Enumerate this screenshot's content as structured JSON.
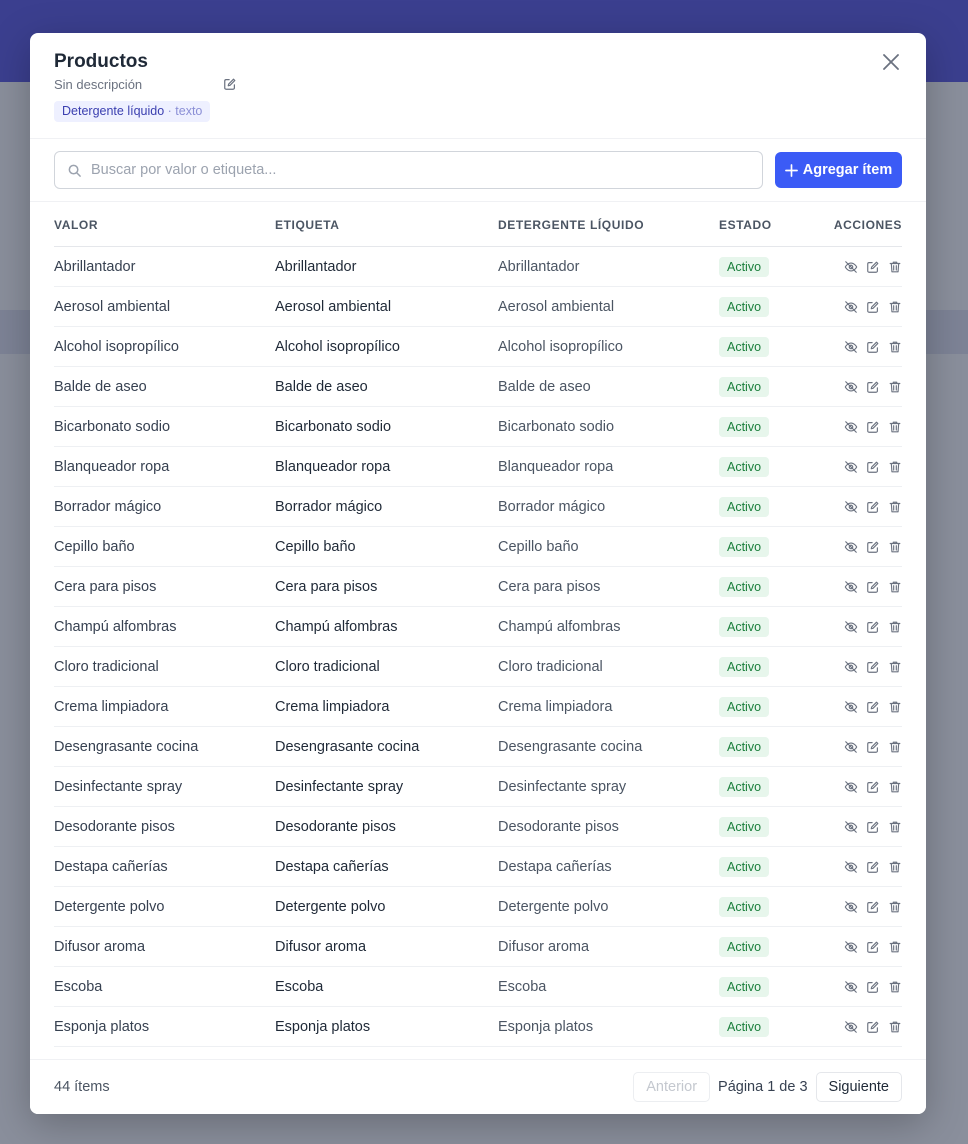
{
  "modal": {
    "title": "Productos",
    "description": "Sin descripción",
    "tag": {
      "name": "Detergente líquido",
      "type": "· texto"
    }
  },
  "search": {
    "placeholder": "Buscar por valor o etiqueta...",
    "value": ""
  },
  "add_button": {
    "label": "Agregar ítem"
  },
  "table": {
    "headers": [
      "Valor",
      "Etiqueta",
      "Detergente líquido",
      "Estado",
      "Acciones"
    ],
    "rows": [
      {
        "valor": "Abrillantador",
        "etiqueta": "Abrillantador",
        "detergente": "Abrillantador",
        "estado": "Activo"
      },
      {
        "valor": "Aerosol ambiental",
        "etiqueta": "Aerosol ambiental",
        "detergente": "Aerosol ambiental",
        "estado": "Activo"
      },
      {
        "valor": "Alcohol isopropílico",
        "etiqueta": "Alcohol isopropílico",
        "detergente": "Alcohol isopropílico",
        "estado": "Activo"
      },
      {
        "valor": "Balde de aseo",
        "etiqueta": "Balde de aseo",
        "detergente": "Balde de aseo",
        "estado": "Activo"
      },
      {
        "valor": "Bicarbonato sodio",
        "etiqueta": "Bicarbonato sodio",
        "detergente": "Bicarbonato sodio",
        "estado": "Activo"
      },
      {
        "valor": "Blanqueador ropa",
        "etiqueta": "Blanqueador ropa",
        "detergente": "Blanqueador ropa",
        "estado": "Activo"
      },
      {
        "valor": "Borrador mágico",
        "etiqueta": "Borrador mágico",
        "detergente": "Borrador mágico",
        "estado": "Activo"
      },
      {
        "valor": "Cepillo baño",
        "etiqueta": "Cepillo baño",
        "detergente": "Cepillo baño",
        "estado": "Activo"
      },
      {
        "valor": "Cera para pisos",
        "etiqueta": "Cera para pisos",
        "detergente": "Cera para pisos",
        "estado": "Activo"
      },
      {
        "valor": "Champú alfombras",
        "etiqueta": "Champú alfombras",
        "detergente": "Champú alfombras",
        "estado": "Activo"
      },
      {
        "valor": "Cloro tradicional",
        "etiqueta": "Cloro tradicional",
        "detergente": "Cloro tradicional",
        "estado": "Activo"
      },
      {
        "valor": "Crema limpiadora",
        "etiqueta": "Crema limpiadora",
        "detergente": "Crema limpiadora",
        "estado": "Activo"
      },
      {
        "valor": "Desengrasante cocina",
        "etiqueta": "Desengrasante cocina",
        "detergente": "Desengrasante cocina",
        "estado": "Activo"
      },
      {
        "valor": "Desinfectante spray",
        "etiqueta": "Desinfectante spray",
        "detergente": "Desinfectante spray",
        "estado": "Activo"
      },
      {
        "valor": "Desodorante pisos",
        "etiqueta": "Desodorante pisos",
        "detergente": "Desodorante pisos",
        "estado": "Activo"
      },
      {
        "valor": "Destapa cañerías",
        "etiqueta": "Destapa cañerías",
        "detergente": "Destapa cañerías",
        "estado": "Activo"
      },
      {
        "valor": "Detergente polvo",
        "etiqueta": "Detergente polvo",
        "detergente": "Detergente polvo",
        "estado": "Activo"
      },
      {
        "valor": "Difusor aroma",
        "etiqueta": "Difusor aroma",
        "detergente": "Difusor aroma",
        "estado": "Activo"
      },
      {
        "valor": "Escoba",
        "etiqueta": "Escoba",
        "detergente": "Escoba",
        "estado": "Activo"
      },
      {
        "valor": "Esponja platos",
        "etiqueta": "Esponja platos",
        "detergente": "Esponja platos",
        "estado": "Activo"
      }
    ]
  },
  "footer": {
    "count": "44 ítems",
    "prev_label": "Anterior",
    "page_info": "Página 1 de 3",
    "next_label": "Siguiente"
  },
  "colors": {
    "accent": "#3b5bf6",
    "header_band": "#3b3f8f",
    "badge_bg": "#e7f6ec",
    "badge_text": "#1a7f3c",
    "tag_bg": "#eef0ff"
  },
  "icons": {
    "close": "close-icon",
    "edit": "edit-icon",
    "search": "search-icon",
    "add": "plus-icon",
    "hide": "eye-off-icon",
    "delete": "trash-icon"
  }
}
